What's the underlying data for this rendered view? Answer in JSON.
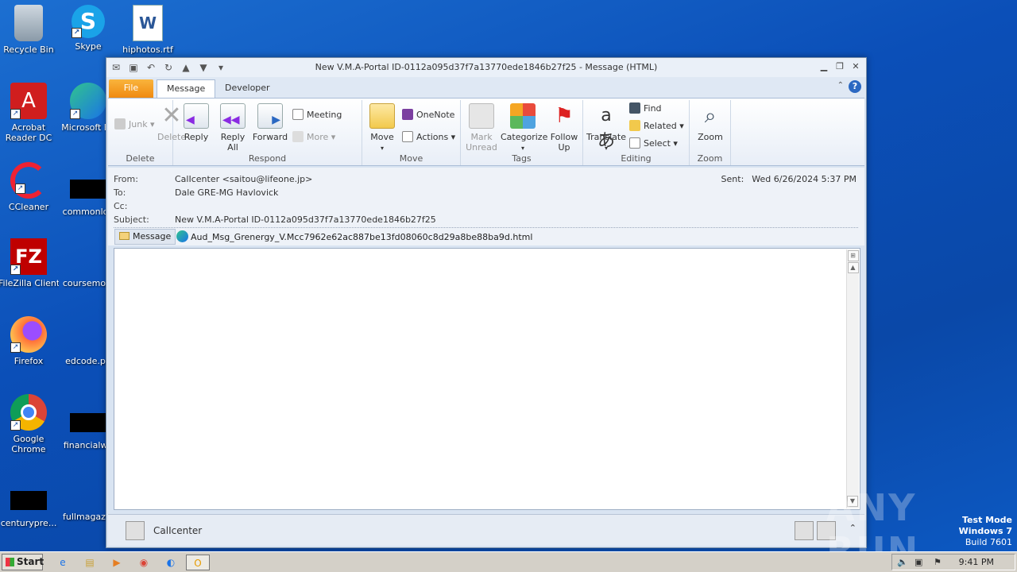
{
  "desktop": {
    "icons": [
      {
        "label": "Recycle Bin"
      },
      {
        "label": "Skype"
      },
      {
        "label": "hiphotos.rtf"
      },
      {
        "label": "Acrobat Reader DC"
      },
      {
        "label": "Microsoft Ed"
      },
      {
        "label": "CCleaner"
      },
      {
        "label": "commonlog"
      },
      {
        "label": "FileZilla Client"
      },
      {
        "label": "coursemoni"
      },
      {
        "label": "Firefox"
      },
      {
        "label": "edcode.pn"
      },
      {
        "label": "Google Chrome"
      },
      {
        "label": "financialwe"
      },
      {
        "label": "centurypre..."
      },
      {
        "label": "fullmagazin"
      }
    ]
  },
  "window": {
    "title": "New V.M.A-Portal ID-0112a095d37f7a13770ede1846b27f25  -  Message (HTML)",
    "tabs": {
      "file": "File",
      "message": "Message",
      "developer": "Developer"
    }
  },
  "ribbon": {
    "delete": {
      "junk": "Junk",
      "delete": "Delete",
      "group": "Delete"
    },
    "respond": {
      "reply": "Reply",
      "reply_all": "Reply All",
      "forward": "Forward",
      "meeting": "Meeting",
      "more": "More",
      "group": "Respond"
    },
    "move": {
      "move": "Move",
      "onenote": "OneNote",
      "actions": "Actions",
      "group": "Move"
    },
    "tags": {
      "mark_unread": "Mark Unread",
      "categorize": "Categorize",
      "follow_up": "Follow Up",
      "group": "Tags"
    },
    "editing": {
      "translate": "Translate",
      "find": "Find",
      "related": "Related",
      "select": "Select",
      "group": "Editing"
    },
    "zoom": {
      "zoom": "Zoom",
      "group": "Zoom"
    }
  },
  "header": {
    "from_label": "From:",
    "from": "CalIcenter <saitou@lifeone.jp>",
    "to_label": "To:",
    "to": "Dale GRE-MG Havlovick",
    "cc_label": "Cc:",
    "subject_label": "Subject:",
    "subject": "New V.M.A-Portal ID-0112a095d37f7a13770ede1846b27f25",
    "sent_label": "Sent:",
    "sent": "Wed 6/26/2024 5:37 PM"
  },
  "attachments": {
    "message_tab": "Message",
    "file": "Aud_Msg_Grenergy_V.Mcc7962e62ac887be13fd08060c8d29a8be88ba9d.html"
  },
  "people_pane": {
    "name": "CalIcenter"
  },
  "watermark": {
    "brand": "ANY RUN"
  },
  "os": {
    "line1": "Test Mode",
    "line2": "Windows 7",
    "line3": "Build 7601"
  },
  "taskbar": {
    "start": "Start",
    "time": "9:41 PM"
  }
}
